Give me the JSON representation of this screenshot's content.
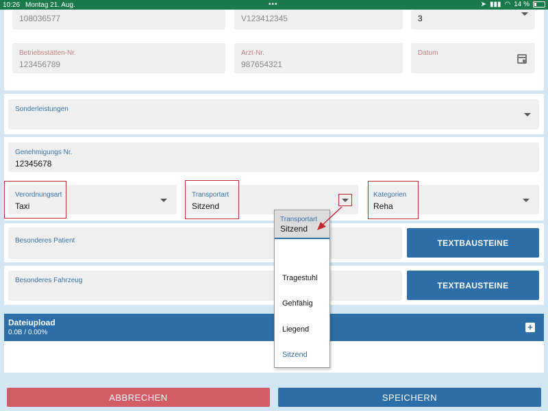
{
  "status_bar": {
    "time": "10:26",
    "date": "Montag 21. Aug.",
    "battery": "14 %"
  },
  "top_fields": {
    "field1_value": "108036577",
    "field2_value": "V123412345",
    "field3_value": "3",
    "betriebsstaetten_label": "Betriebsstätten-Nr.",
    "betriebsstaetten_value": "123456789",
    "arzt_label": "Arzt-Nr.",
    "arzt_value": "987654321",
    "datum_label": "Datum"
  },
  "sonderleistungen": {
    "label": "Sonderleistungen"
  },
  "genehmigung": {
    "label": "Genehmigungs Nr.",
    "value": "12345678"
  },
  "verordnungsart": {
    "label": "Verordnungsart",
    "value": "Taxi"
  },
  "transportart": {
    "label": "Transportart",
    "value": "Sitzend"
  },
  "kategorien": {
    "label": "Kategorien",
    "value": "Reha"
  },
  "besonderes_patient": {
    "label": "Besonderes Patient",
    "button": "TEXTBAUSTEINE"
  },
  "besonderes_fahrzeug": {
    "label": "Besonderes Fahrzeug",
    "button": "TEXTBAUSTEINE"
  },
  "dateiupload": {
    "title": "Dateiupload",
    "progress": "0.0B / 0.00%"
  },
  "dropdown": {
    "label": "Transportart",
    "value": "Sitzend",
    "options": [
      "Tragestuhl",
      "Gehfähig",
      "Liegend",
      "Sitzend"
    ]
  },
  "actions": {
    "cancel": "ABBRECHEN",
    "save": "SPEICHERN"
  },
  "colors": {
    "accent": "#2c6ea8",
    "cancel": "#d45c66",
    "highlight": "#c0282c"
  }
}
